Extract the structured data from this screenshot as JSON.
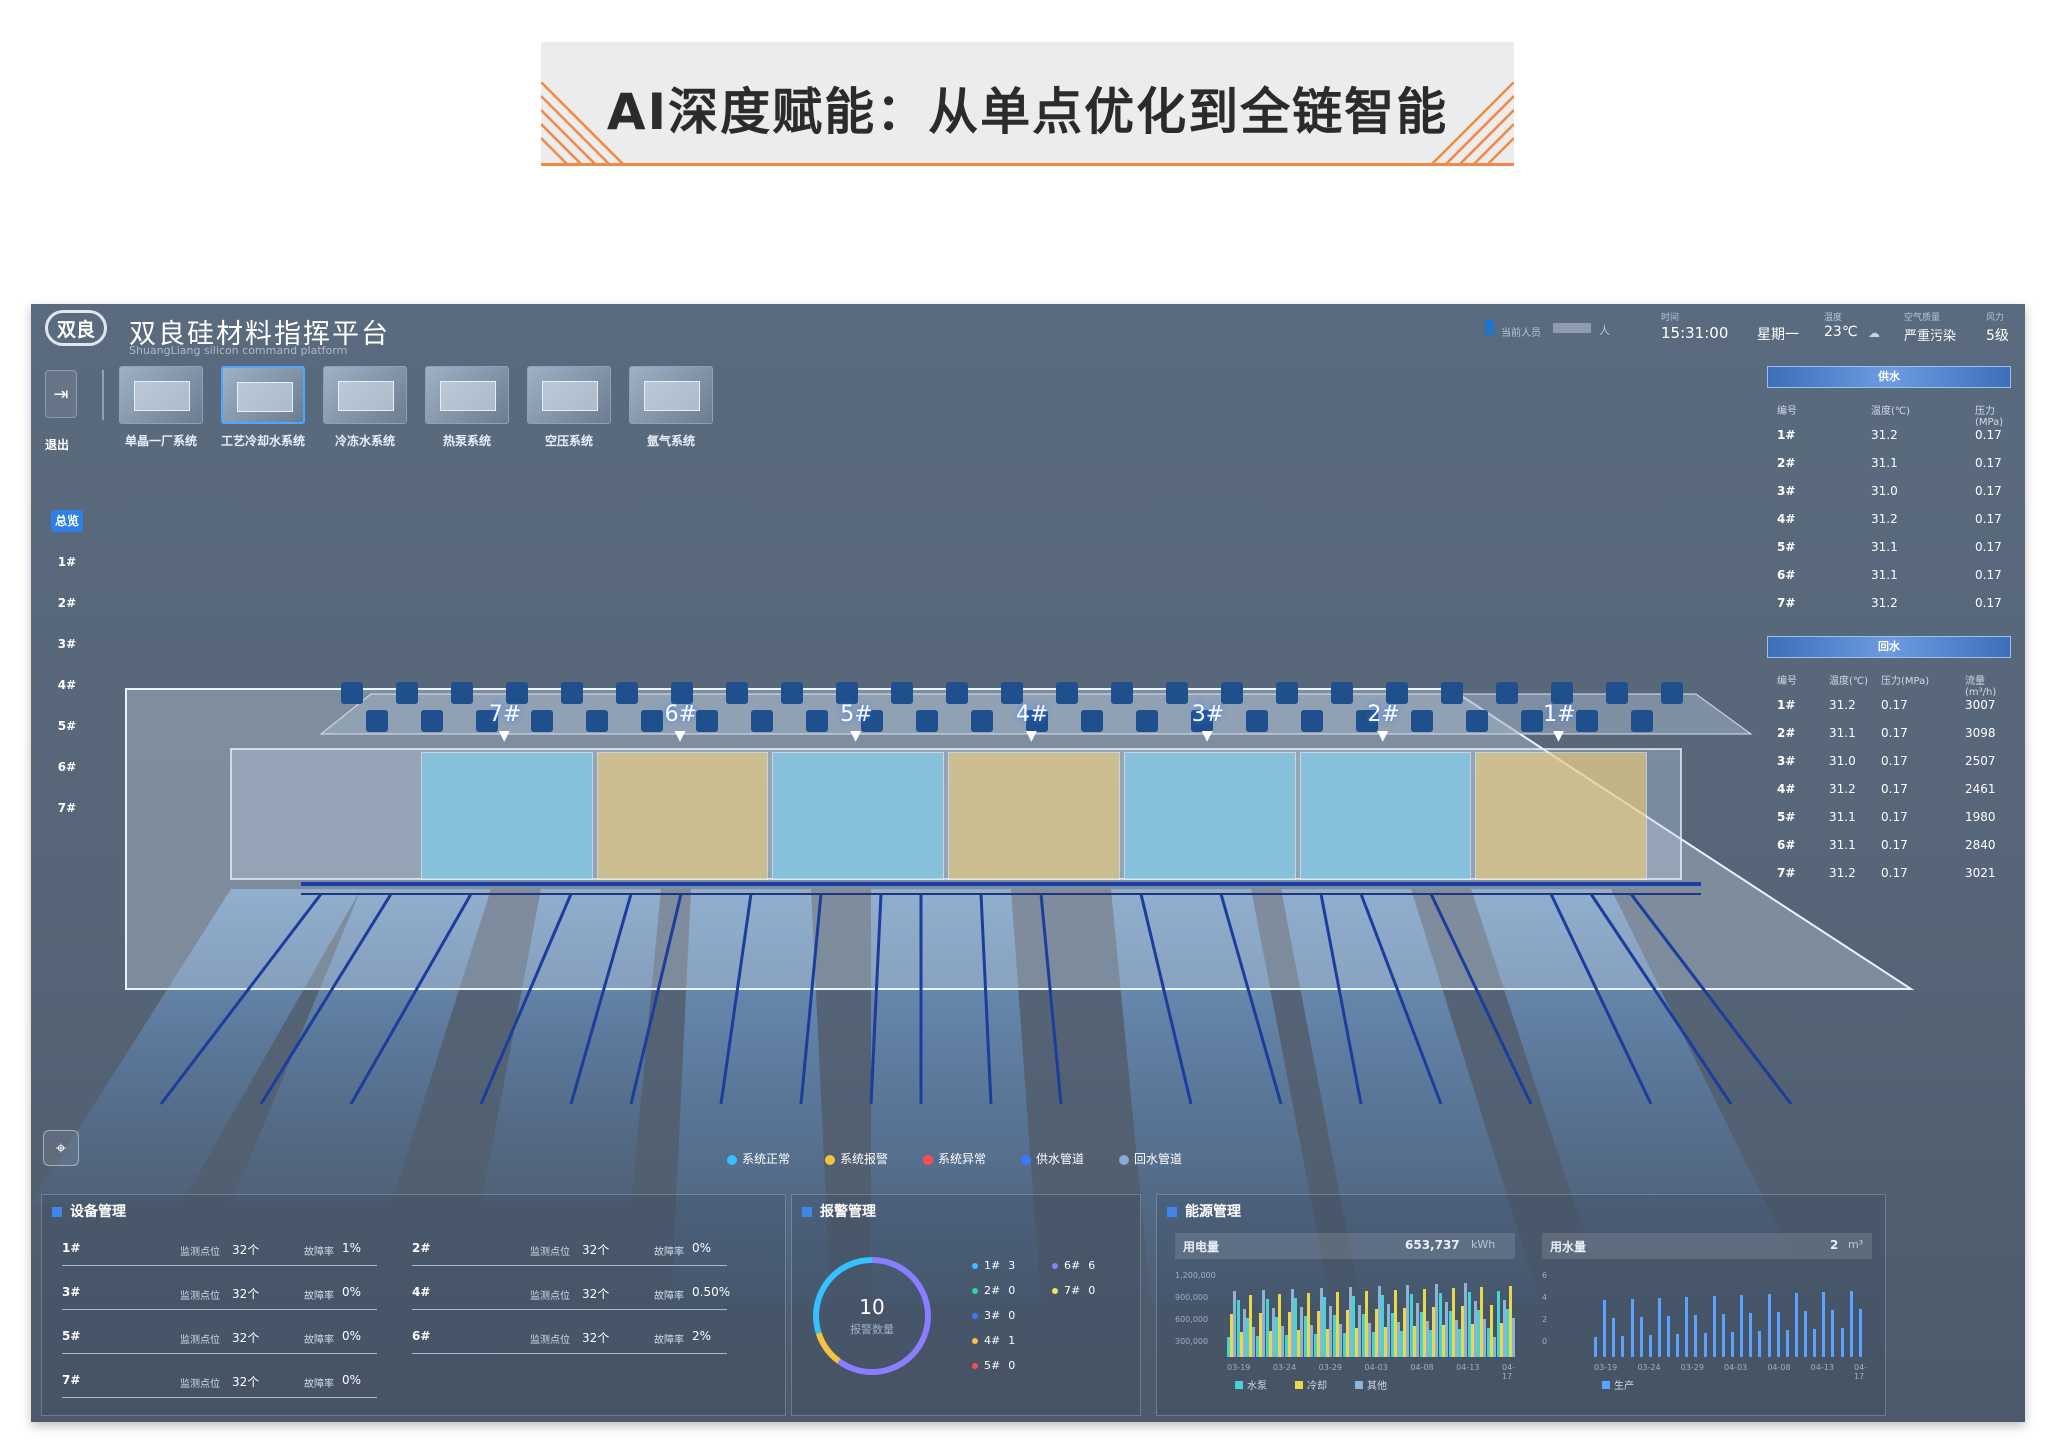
{
  "slide": {
    "title": "AI深度赋能：从单点优化到全链智能"
  },
  "app": {
    "logo": "双良",
    "title": "双良硅材料指挥平台",
    "subtitle": "ShuangLiang silicon command platform"
  },
  "topbar": {
    "user_label": "当前人员",
    "user_suffix": "人",
    "time_label": "时间",
    "time": "15:31:00",
    "weekday": "星期一",
    "temp_label": "温度",
    "temp": "23℃",
    "air_label": "空气质量",
    "air": "严重污染",
    "wind_label": "风力",
    "wind": "5级"
  },
  "exit": {
    "label": "退出"
  },
  "systems": [
    {
      "label": "单晶一厂系统",
      "active": false
    },
    {
      "label": "工艺冷却水系统",
      "active": true
    },
    {
      "label": "冷冻水系统",
      "active": false
    },
    {
      "label": "热泵系统",
      "active": false
    },
    {
      "label": "空压系统",
      "active": false
    },
    {
      "label": "氩气系统",
      "active": false
    }
  ],
  "floors": [
    "总览",
    "1#",
    "2#",
    "3#",
    "4#",
    "5#",
    "6#",
    "7#"
  ],
  "supply": {
    "title": "供水",
    "headers": [
      "编号",
      "温度(℃)",
      "压力(MPa)"
    ],
    "rows": [
      [
        "1#",
        "31.2",
        "0.17"
      ],
      [
        "2#",
        "31.1",
        "0.17"
      ],
      [
        "3#",
        "31.0",
        "0.17"
      ],
      [
        "4#",
        "31.2",
        "0.17"
      ],
      [
        "5#",
        "31.1",
        "0.17"
      ],
      [
        "6#",
        "31.1",
        "0.17"
      ],
      [
        "7#",
        "31.2",
        "0.17"
      ]
    ]
  },
  "return": {
    "title": "回水",
    "headers": [
      "编号",
      "温度(℃)",
      "压力(MPa)",
      "流量(m³/h)"
    ],
    "rows": [
      [
        "1#",
        "31.2",
        "0.17",
        "3007"
      ],
      [
        "2#",
        "31.1",
        "0.17",
        "3098"
      ],
      [
        "3#",
        "31.0",
        "0.17",
        "2507"
      ],
      [
        "4#",
        "31.2",
        "0.17",
        "2461"
      ],
      [
        "5#",
        "31.1",
        "0.17",
        "1980"
      ],
      [
        "6#",
        "31.1",
        "0.17",
        "2840"
      ],
      [
        "7#",
        "31.2",
        "0.17",
        "3021"
      ]
    ]
  },
  "zones": [
    "7#",
    "6#",
    "5#",
    "4#",
    "3#",
    "2#",
    "1#"
  ],
  "zone_colors": [
    "#7fd3f2",
    "#f2cf7a",
    "#7fd3f2",
    "#f2cf7a",
    "#7fd3f2",
    "#7fd3f2",
    "#f2cf7a"
  ],
  "legend": [
    {
      "label": "系统正常",
      "color": "#36c0ff"
    },
    {
      "label": "系统报警",
      "color": "#f5c242"
    },
    {
      "label": "系统异常",
      "color": "#ff4d4f"
    },
    {
      "label": "供水管道",
      "color": "#3a78ff"
    },
    {
      "label": "回水管道",
      "color": "#8aa8d8"
    }
  ],
  "equipment": {
    "title": "设备管理",
    "monitor_label": "监测点位",
    "fault_label": "故障率",
    "items": [
      {
        "id": "1#",
        "points": "32个",
        "rate": "1%"
      },
      {
        "id": "2#",
        "points": "32个",
        "rate": "0%"
      },
      {
        "id": "3#",
        "points": "32个",
        "rate": "0%"
      },
      {
        "id": "4#",
        "points": "32个",
        "rate": "0.50%"
      },
      {
        "id": "5#",
        "points": "32个",
        "rate": "0%"
      },
      {
        "id": "6#",
        "points": "32个",
        "rate": "2%"
      },
      {
        "id": "7#",
        "points": "32个",
        "rate": "0%"
      }
    ]
  },
  "alarm": {
    "title": "报警管理",
    "count": "10",
    "count_label": "报警数量",
    "items": [
      {
        "id": "1#",
        "count": "3",
        "color": "#36c0ff"
      },
      {
        "id": "2#",
        "count": "0",
        "color": "#31d49a"
      },
      {
        "id": "3#",
        "count": "0",
        "color": "#3a78ff"
      },
      {
        "id": "4#",
        "count": "1",
        "color": "#f5c242"
      },
      {
        "id": "5#",
        "count": "0",
        "color": "#ff4d4f"
      },
      {
        "id": "6#",
        "count": "6",
        "color": "#8a7dff"
      },
      {
        "id": "7#",
        "count": "0",
        "color": "#f5e35a"
      }
    ]
  },
  "energy": {
    "title": "能源管理",
    "electric_label": "用电量",
    "electric_value": "653,737",
    "electric_unit": "kWh",
    "water_label": "用水量",
    "water_value": "2",
    "water_unit": "m³",
    "electric_yticks": [
      "1,200,000",
      "900,000",
      "600,000",
      "300,000"
    ],
    "water_yticks": [
      "6",
      "4",
      "2",
      "0"
    ],
    "xticks": [
      "03-19",
      "03-24",
      "03-29",
      "04-03",
      "04-08",
      "04-13",
      "04-17"
    ],
    "electric_legend": [
      {
        "label": "水泵",
        "color": "#46d3d6"
      },
      {
        "label": "冷却",
        "color": "#e8d84a"
      },
      {
        "label": "其他",
        "color": "#8fb3d6"
      }
    ],
    "water_legend": [
      {
        "label": "生产",
        "color": "#5aa3ff"
      }
    ],
    "accent": "#2f7fe8"
  }
}
